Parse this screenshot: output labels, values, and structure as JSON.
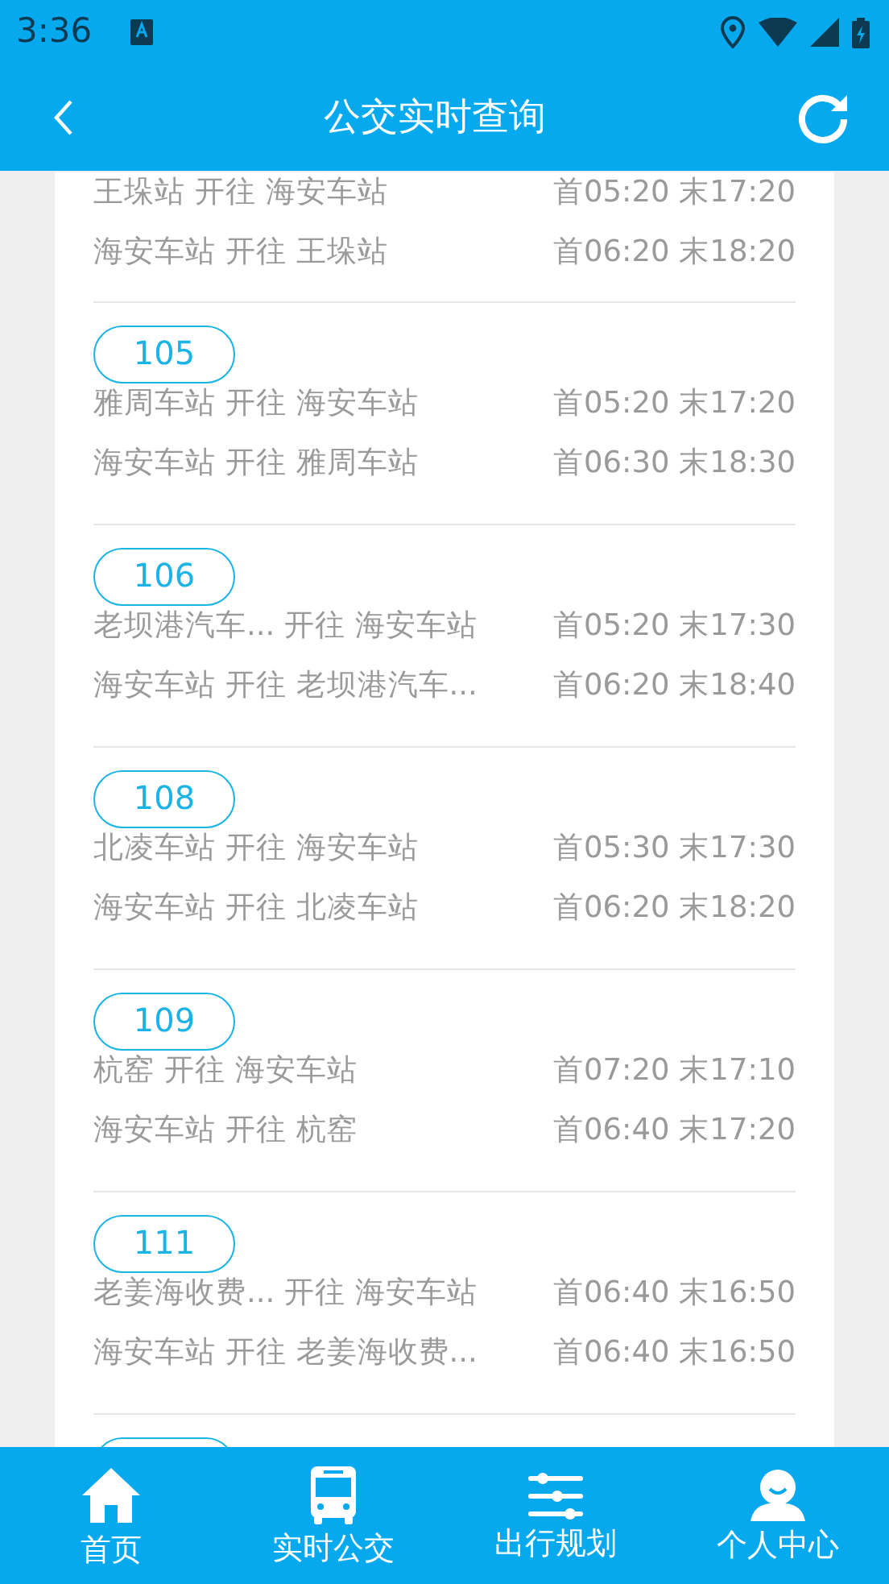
{
  "status_bar": {
    "time": "3:36"
  },
  "toolbar": {
    "title": "公交实时查询"
  },
  "routes": [
    {
      "kind": "continued",
      "trips": [
        {
          "direction": "王垛站 开往 海安车站",
          "times": "首05:20 末17:20"
        },
        {
          "direction": "海安车站 开往 王垛站",
          "times": "首06:20 末18:20"
        }
      ]
    },
    {
      "kind": "route",
      "route": "105",
      "trips": [
        {
          "direction": "雅周车站 开往 海安车站",
          "times": "首05:20 末17:20"
        },
        {
          "direction": "海安车站 开往 雅周车站",
          "times": "首06:30 末18:30"
        }
      ]
    },
    {
      "kind": "route",
      "route": "106",
      "trips": [
        {
          "direction": "老坝港汽车... 开往 海安车站",
          "times": "首05:20 末17:30"
        },
        {
          "direction": "海安车站 开往 老坝港汽车...",
          "times": "首06:20 末18:40"
        }
      ]
    },
    {
      "kind": "route",
      "route": "108",
      "trips": [
        {
          "direction": "北凌车站 开往 海安车站",
          "times": "首05:30 末17:30"
        },
        {
          "direction": "海安车站 开往 北凌车站",
          "times": "首06:20 末18:20"
        }
      ]
    },
    {
      "kind": "route",
      "route": "109",
      "trips": [
        {
          "direction": "杭窑 开往 海安车站",
          "times": "首07:20 末17:10"
        },
        {
          "direction": "海安车站 开往 杭窑",
          "times": "首06:40 末17:20"
        }
      ]
    },
    {
      "kind": "route",
      "route": "111",
      "trips": [
        {
          "direction": "老姜海收费... 开往 海安车站",
          "times": "首06:40 末16:50"
        },
        {
          "direction": "海安车站 开往 老姜海收费...",
          "times": "首06:40 末16:50"
        }
      ]
    },
    {
      "kind": "cut_off"
    }
  ],
  "bottom_nav": [
    {
      "kind": "home",
      "label": "首页"
    },
    {
      "kind": "bus",
      "label": "实时公交"
    },
    {
      "kind": "sliders",
      "label": "出行规划"
    },
    {
      "kind": "user",
      "label": "个人中心"
    }
  ]
}
